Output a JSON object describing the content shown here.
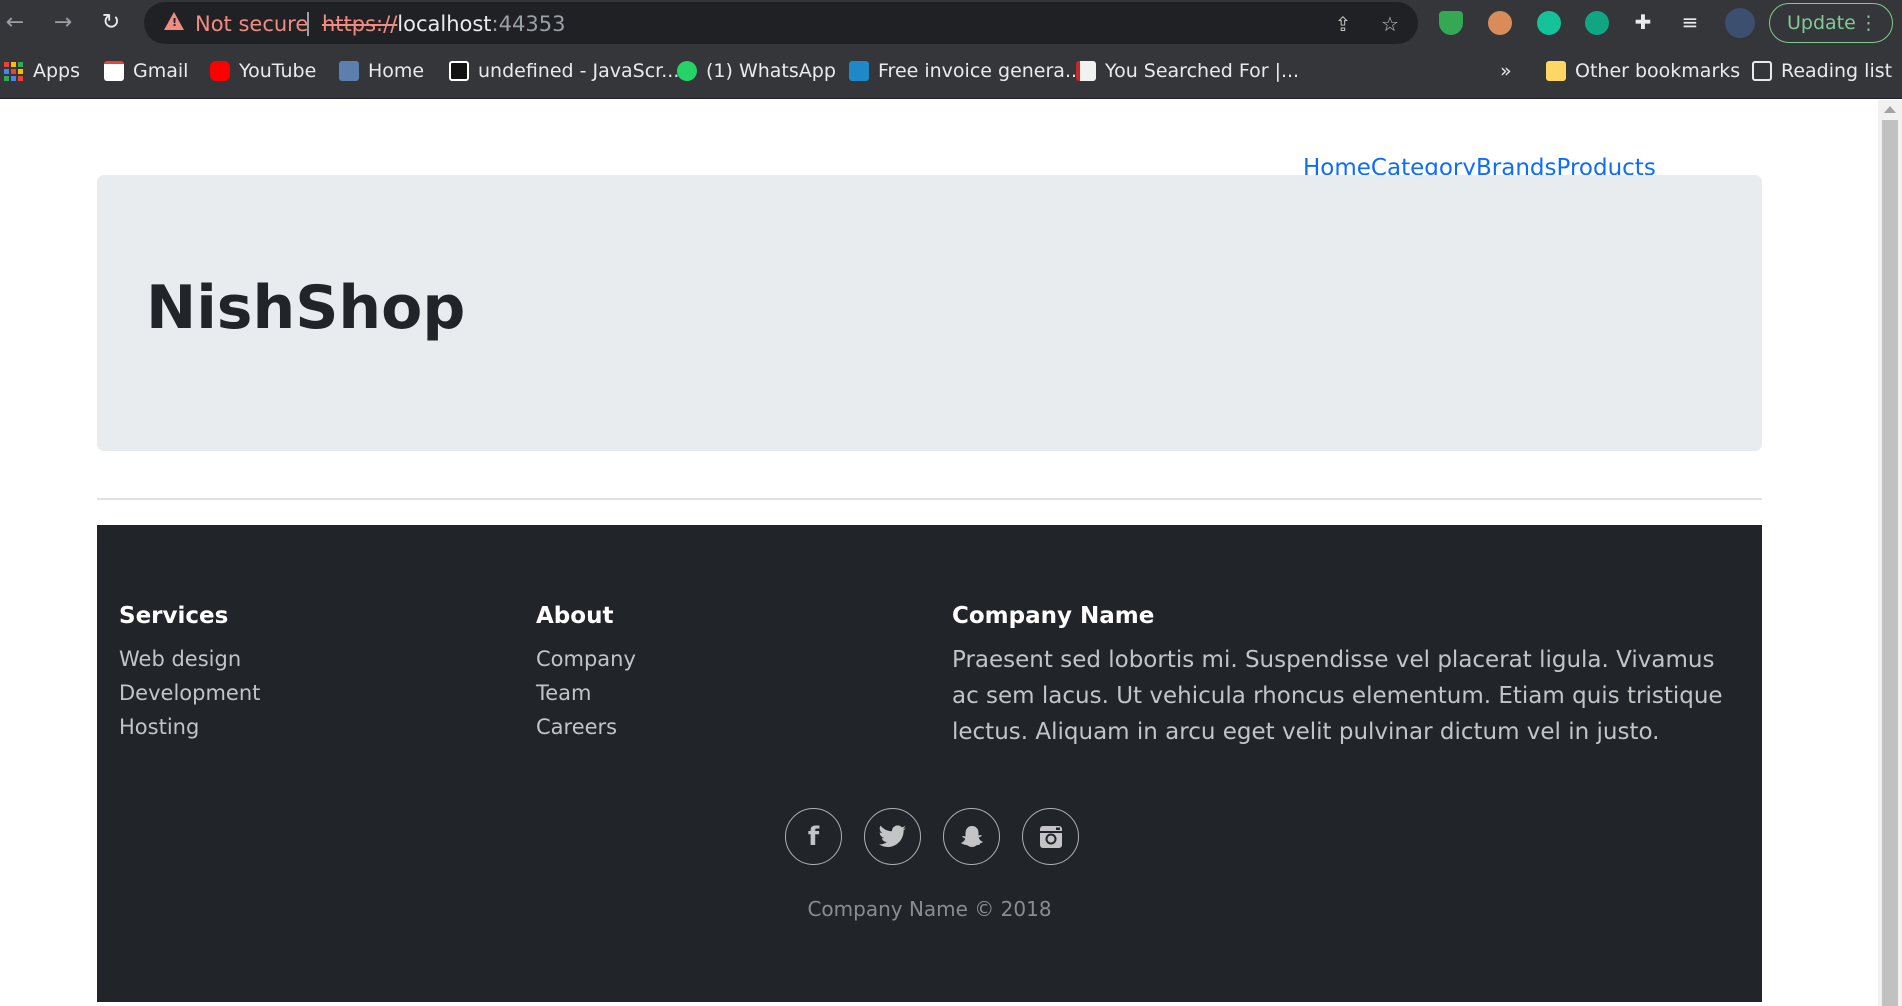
{
  "browser": {
    "security_label": "Not secure",
    "url_scheme": "https://",
    "url_host": "localhost",
    "url_port": ":44353",
    "update_label": "Update",
    "bookmarks": [
      {
        "label": "Apps",
        "icon": "apps-grid-icon"
      },
      {
        "label": "Gmail",
        "icon": "gmail-icon"
      },
      {
        "label": "YouTube",
        "icon": "youtube-icon"
      },
      {
        "label": "Home",
        "icon": "home-bookmark-icon"
      },
      {
        "label": "undefined - JavaScr...",
        "icon": "javascript-bookmark-icon"
      },
      {
        "label": "(1) WhatsApp",
        "icon": "whatsapp-icon"
      },
      {
        "label": "Free invoice genera...",
        "icon": "invoice-icon"
      },
      {
        "label": "You Searched For |...",
        "icon": "search-result-icon"
      }
    ],
    "overflow_label": "»",
    "other_bookmarks": "Other bookmarks",
    "reading_list": "Reading list"
  },
  "nav": {
    "links": [
      "Home",
      "Category",
      "Brands",
      "Products"
    ]
  },
  "hero": {
    "title": "NishShop"
  },
  "footer": {
    "services": {
      "title": "Services",
      "links": [
        "Web design",
        "Development",
        "Hosting"
      ]
    },
    "about": {
      "title": "About",
      "links": [
        "Company",
        "Team",
        "Careers"
      ]
    },
    "company": {
      "title": "Company Name",
      "text": "Praesent sed lobortis mi. Suspendisse vel placerat ligula. Vivamus ac sem lacus. Ut vehicula rhoncus elementum. Etiam quis tristique lectus. Aliquam in arcu eget velit pulvinar dictum vel in justo."
    },
    "social": [
      "facebook-icon",
      "twitter-icon",
      "snapchat-icon",
      "instagram-icon"
    ],
    "copyright": "Company Name © 2018"
  },
  "colors": {
    "link": "#0d6efd",
    "footer_bg": "#212529",
    "hero_bg": "#e9ecef"
  }
}
